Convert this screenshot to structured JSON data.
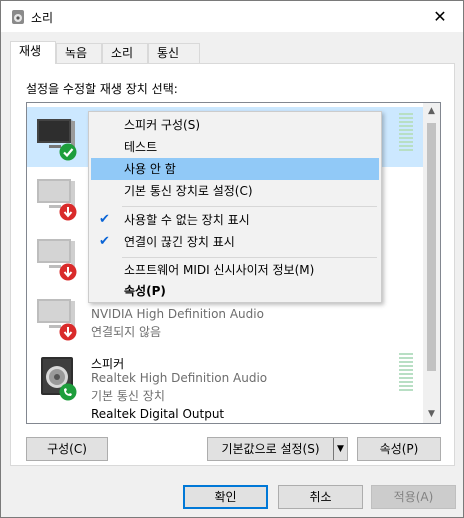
{
  "window": {
    "title": "소리",
    "close_glyph": "✕"
  },
  "tabs": [
    {
      "label": "재생",
      "active": true
    },
    {
      "label": "녹음",
      "active": false
    },
    {
      "label": "소리",
      "active": false
    },
    {
      "label": "통신",
      "active": false
    }
  ],
  "instruction": "설정을 수정할 재생 장치 선택:",
  "devices": [
    {
      "name": "",
      "sub": "",
      "sub2": "",
      "icon": "monitor-icon",
      "badge": "check-badge-icon",
      "selected": true
    },
    {
      "name": "",
      "sub": "",
      "sub2": "",
      "icon": "monitor-icon",
      "badge": "down-arrow-badge-icon",
      "selected": false
    },
    {
      "name": "",
      "sub": "",
      "sub2": "",
      "icon": "monitor-icon",
      "badge": "down-arrow-badge-icon",
      "selected": false
    },
    {
      "name": "",
      "sub": "NVIDIA High Definition Audio",
      "sub2": "연결되지 않음",
      "icon": "monitor-icon",
      "badge": "down-arrow-badge-icon",
      "selected": false
    },
    {
      "name": "스피커",
      "sub": "Realtek High Definition Audio",
      "sub2": "기본 통신 장치",
      "icon": "speaker-icon",
      "badge": "phone-badge-icon",
      "selected": false
    },
    {
      "name": "Realtek Digital Output",
      "sub": "",
      "sub2": "",
      "icon": "",
      "badge": "",
      "selected": false
    }
  ],
  "context_menu": {
    "items": [
      {
        "label": "스피커 구성(S)"
      },
      {
        "label": "테스트"
      },
      {
        "label": "사용 안 함",
        "highlighted": true
      },
      {
        "label": "기본 통신 장치로 설정(C)"
      },
      {
        "label": "사용할 수 없는 장치 표시",
        "checked": true
      },
      {
        "label": "연결이 끊긴 장치 표시",
        "checked": true
      },
      {
        "label": "소프트웨어 MIDI 신시사이저 정보(M)"
      },
      {
        "label": "속성(P)",
        "bold": true
      }
    ],
    "check_glyph": "✔"
  },
  "panel_buttons": {
    "configure": "구성(C)",
    "set_default": "기본값으로 설정(S)",
    "split_arrow": "▼",
    "properties": "속성(P)"
  },
  "dialog_buttons": {
    "ok": "확인",
    "cancel": "취소",
    "apply": "적용(A)"
  },
  "scrollbar": {
    "up": "▲",
    "down": "▼"
  },
  "colors": {
    "selected_row": "#cce8ff",
    "menu_highlight": "#91c9f7",
    "accent": "#0078d7",
    "check_green": "#1e9e3c",
    "down_red": "#d92b2b"
  }
}
